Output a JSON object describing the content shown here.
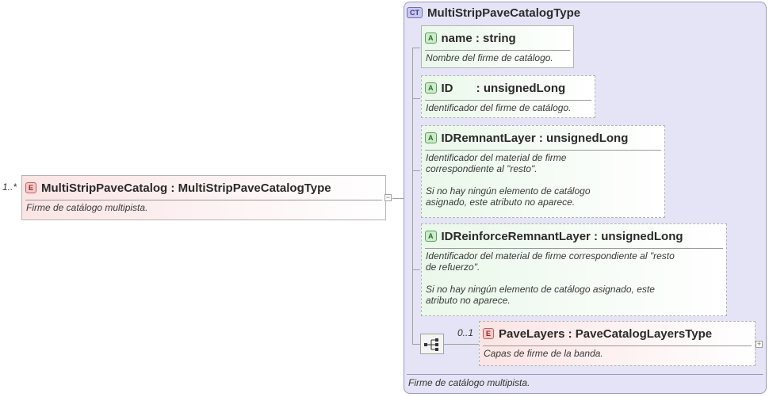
{
  "root_element": {
    "occurrence": "1..*",
    "badge": "E",
    "name": "MultiStripPaveCatalog",
    "separator": " : ",
    "type": "MultiStripPaveCatalogType",
    "doc": "Firme de catálogo multipista."
  },
  "complex_type": {
    "badge": "CT",
    "name": "MultiStripPaveCatalogType",
    "doc": "Firme de catálogo multipista."
  },
  "attributes": [
    {
      "badge": "A",
      "name": "name",
      "separator": " : ",
      "type": "string",
      "doc": "Nombre del firme de catálogo.",
      "required": true
    },
    {
      "badge": "A",
      "name": "ID",
      "separator": "       : ",
      "type": "unsignedLong",
      "doc": "Identificador del firme de catálogo.",
      "required": false
    },
    {
      "badge": "A",
      "name": "IDRemnantLayer",
      "separator": " : ",
      "type": "unsignedLong",
      "doc": "Identificador del material de firme\ncorrespondiente al \"resto\".\n\nSi no hay ningún elemento de catálogo\nasignado, este atributo no aparece.",
      "required": false
    },
    {
      "badge": "A",
      "name": "IDReinforceRemnantLayer",
      "separator": " : ",
      "type": "unsignedLong",
      "doc": "Identificador del material de firme correspondiente al \"resto\nde refuerzo\".\n\nSi no hay ningún elemento de catálogo asignado, este\natributo no aparece.",
      "required": false
    }
  ],
  "child_element": {
    "occurrence": "0..1",
    "badge": "E",
    "name": "PaveLayers",
    "separator": " : ",
    "type": "PaveCatalogLayersType",
    "doc": "Capas de firme de la banda."
  },
  "icons": {
    "collapse": "−",
    "expand": "+",
    "sequence": "sequence-compositor-icon"
  }
}
